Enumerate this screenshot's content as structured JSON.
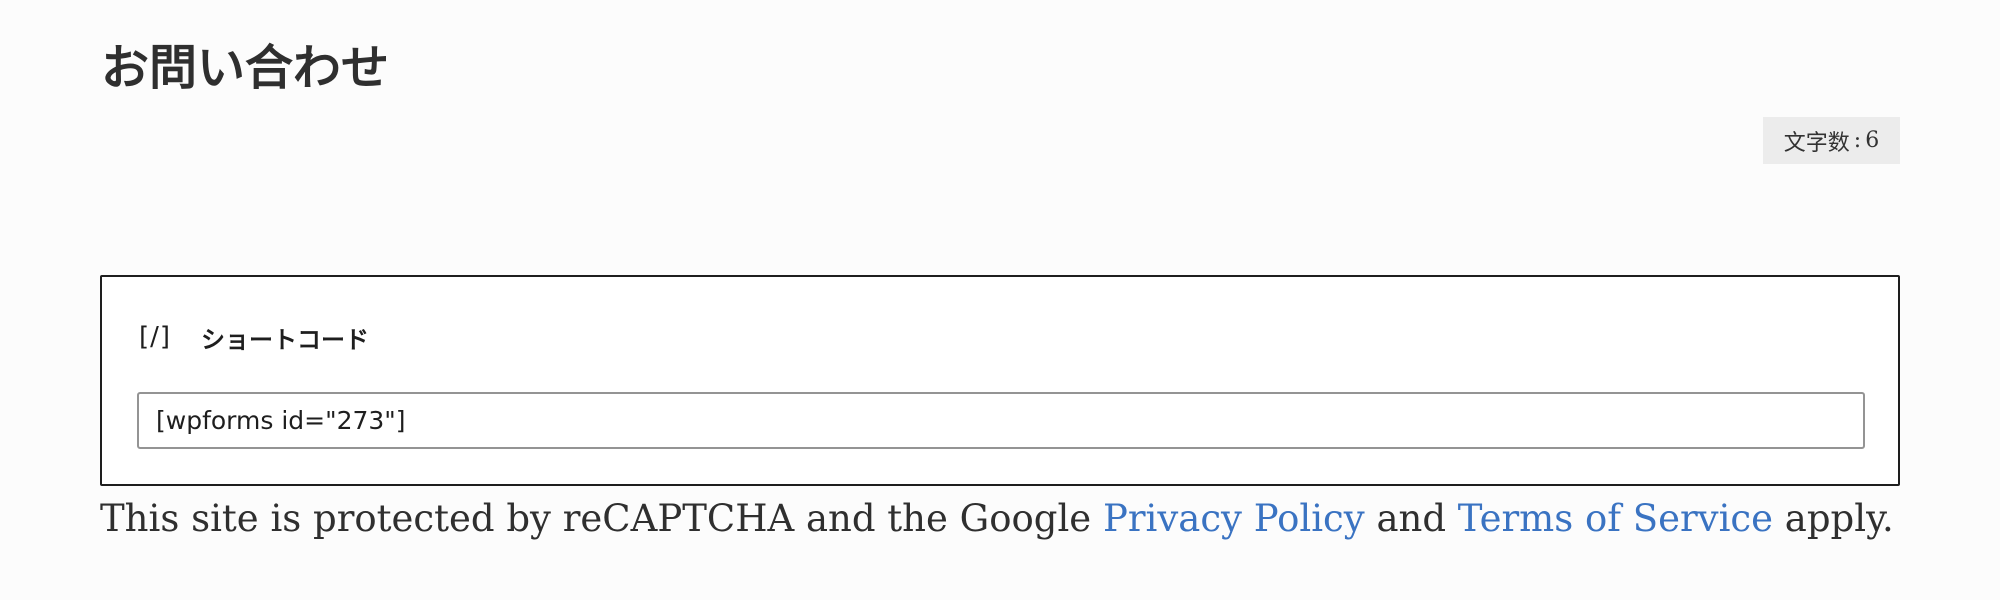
{
  "page": {
    "title": "お問い合わせ",
    "char_count": {
      "label": "文字数",
      "separator": ":",
      "value": "6"
    }
  },
  "shortcode_block": {
    "icon": "[/]",
    "icon_name": "shortcode-icon",
    "label": "ショートコード",
    "value": "[wpforms id=\"273\"]"
  },
  "recaptcha": {
    "prefix": "This site is protected by reCAPTCHA and the Google ",
    "privacy_link": "Privacy Policy",
    "and_text": " and ",
    "terms_link": "Terms of Service",
    "suffix": " apply."
  },
  "colors": {
    "background": "#fcfcfc",
    "link": "#3a73c2",
    "block_border": "#1e1e1e",
    "badge_background": "#ececec"
  }
}
